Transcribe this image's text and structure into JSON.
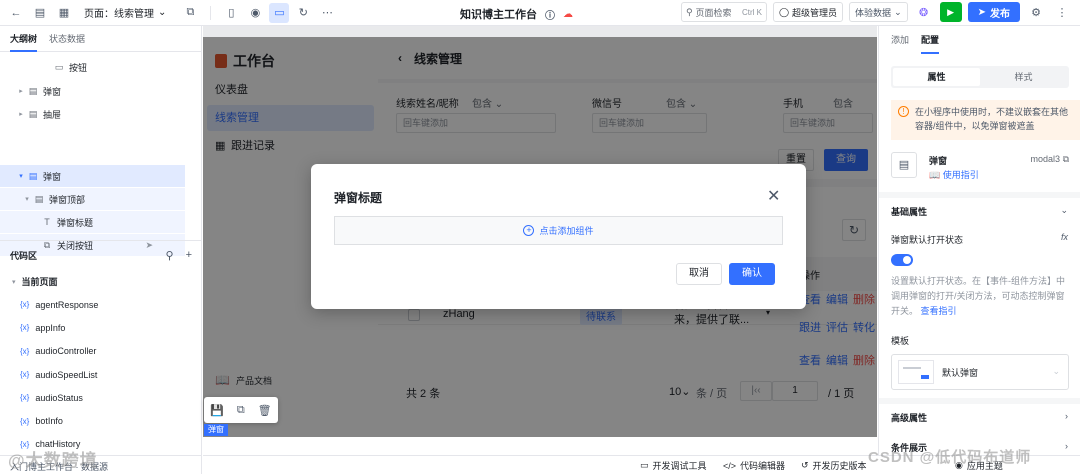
{
  "topbar": {
    "page_label": "页面：线索管理",
    "app_title": "知识博主工作台",
    "search_placeholder": "页面检索",
    "search_shortcut": "Ctrl K",
    "user_role": "超级管理员",
    "experience_data": "体验数据",
    "publish": "发布"
  },
  "left_panel": {
    "tabs": [
      "大纲树",
      "状态数据"
    ],
    "tree": [
      {
        "label": "按钮",
        "indent": 3
      },
      {
        "label": "弹窗",
        "indent": 1
      },
      {
        "label": "抽屉",
        "indent": 1
      },
      {
        "label": "弹窗",
        "indent": 1,
        "selected": true
      },
      {
        "label": "弹窗顶部",
        "indent": 2
      },
      {
        "label": "弹窗标题",
        "indent": 3
      },
      {
        "label": "关闭按钮",
        "indent": 3
      }
    ],
    "code_title": "代码区",
    "code_group": "当前页面",
    "code_items": [
      "agentResponse",
      "appInfo",
      "audioController",
      "audioSpeedList",
      "audioStatus",
      "botInfo",
      "chatHistory"
    ],
    "code_prefix": "{x}"
  },
  "canvas": {
    "nav_brand": "工作台",
    "nav_items": [
      "仪表盘",
      "线索管理",
      "跟进记录"
    ],
    "nav_doc": "产品文档",
    "page_title": "线索管理",
    "filters": [
      {
        "label": "线索姓名/昵称",
        "op": "包含",
        "placeholder": "回车键添加"
      },
      {
        "label": "微信号",
        "op": "包含",
        "placeholder": "回车键添加"
      },
      {
        "label": "手机",
        "op": "包含",
        "placeholder": "回车键添加"
      }
    ],
    "reset": "重置",
    "query": "查询",
    "op_header": "操作",
    "row": {
      "name": "zHang",
      "status": "待联系",
      "desc_line1": "客户从抖音过",
      "desc_line2": "来，提供了联..."
    },
    "actions_row1": [
      "查看",
      "编辑",
      "删除"
    ],
    "actions_row2": [
      "跟进",
      "评估",
      "转化"
    ],
    "actions_row3": [
      "查看",
      "编辑",
      "删除"
    ],
    "total": "共 2 条",
    "page_size": "10",
    "per_page": "条 / 页",
    "page_input": "1",
    "page_total": "/ 1 页",
    "selected_badge": "弹窗"
  },
  "dialog": {
    "title": "弹窗标题",
    "add_component": "点击添加组件",
    "cancel": "取消",
    "confirm": "确认"
  },
  "right_panel": {
    "tabs": [
      "添加",
      "配置"
    ],
    "segments": [
      "属性",
      "样式"
    ],
    "warning": "在小程序中使用时，不建议嵌套在其他容器/组件中，以免弹窗被遮盖",
    "component_name": "弹窗",
    "component_id": "modal3",
    "usage_guide": "使用指引",
    "basic_props": "基础属性",
    "default_open_label": "弹窗默认打开状态",
    "fx": "fx",
    "default_open_desc": "设置默认打开状态。在【事件-组件方法】中调用弹窗的打开/关闭方法，可动态控制弹窗开关。",
    "view_guide": "查看指引",
    "template_label": "模板",
    "template_name": "默认弹窗",
    "advanced_props": "高级属性",
    "condition": "条件展示"
  },
  "statusbar": {
    "left_text": "入门博主工作台 · 数据源",
    "debug_tool": "开发调试工具",
    "code_editor": "代码编辑器",
    "history": "开发历史版本",
    "theme": "应用主题"
  },
  "watermarks": {
    "left": "@大数跨境",
    "right": "CSDN @低代码布道师"
  },
  "colors": {
    "accent": "#3370ff",
    "run": "#00b42a",
    "warning_bg": "#fff3e8",
    "danger": "#f54a45"
  }
}
